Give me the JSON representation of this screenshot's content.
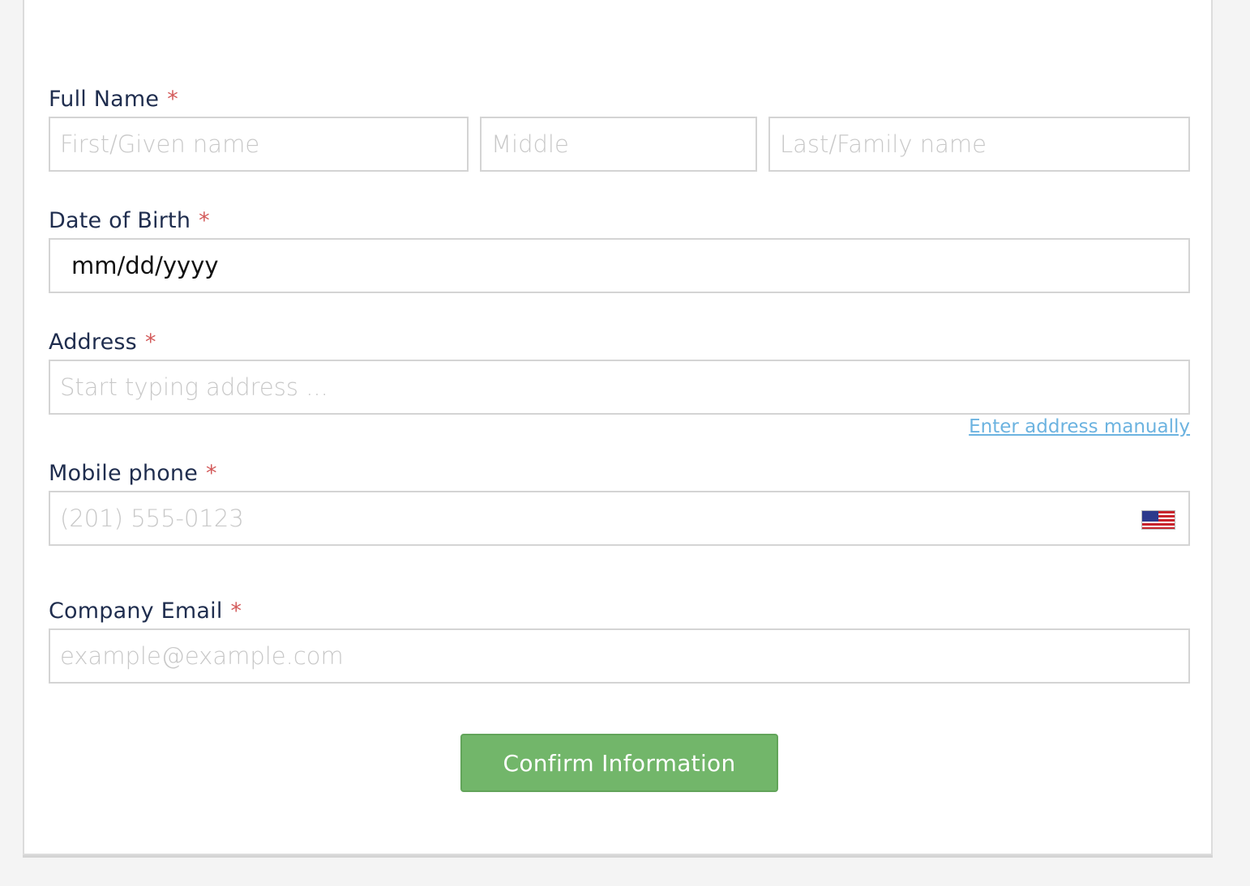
{
  "form": {
    "full_name": {
      "label": "Full Name",
      "required_mark": "*",
      "first_placeholder": "First/Given name",
      "middle_placeholder": "Middle",
      "last_placeholder": "Last/Family name"
    },
    "dob": {
      "label": "Date of Birth",
      "required_mark": "*",
      "value": "mm/dd/yyyy"
    },
    "address": {
      "label": "Address",
      "required_mark": "*",
      "placeholder": "Start typing address ...",
      "manual_link": "Enter address manually"
    },
    "phone": {
      "label": "Mobile phone",
      "required_mark": "*",
      "placeholder": "(201) 555-0123",
      "country_flag_icon": "us-flag-icon"
    },
    "email": {
      "label": "Company Email",
      "required_mark": "*",
      "placeholder": "example@example.com"
    },
    "submit_label": "Confirm Information"
  },
  "colors": {
    "label": "#1f2d4e",
    "required": "#d35a5a",
    "link": "#6cb3e0",
    "button": "#72b66a"
  }
}
